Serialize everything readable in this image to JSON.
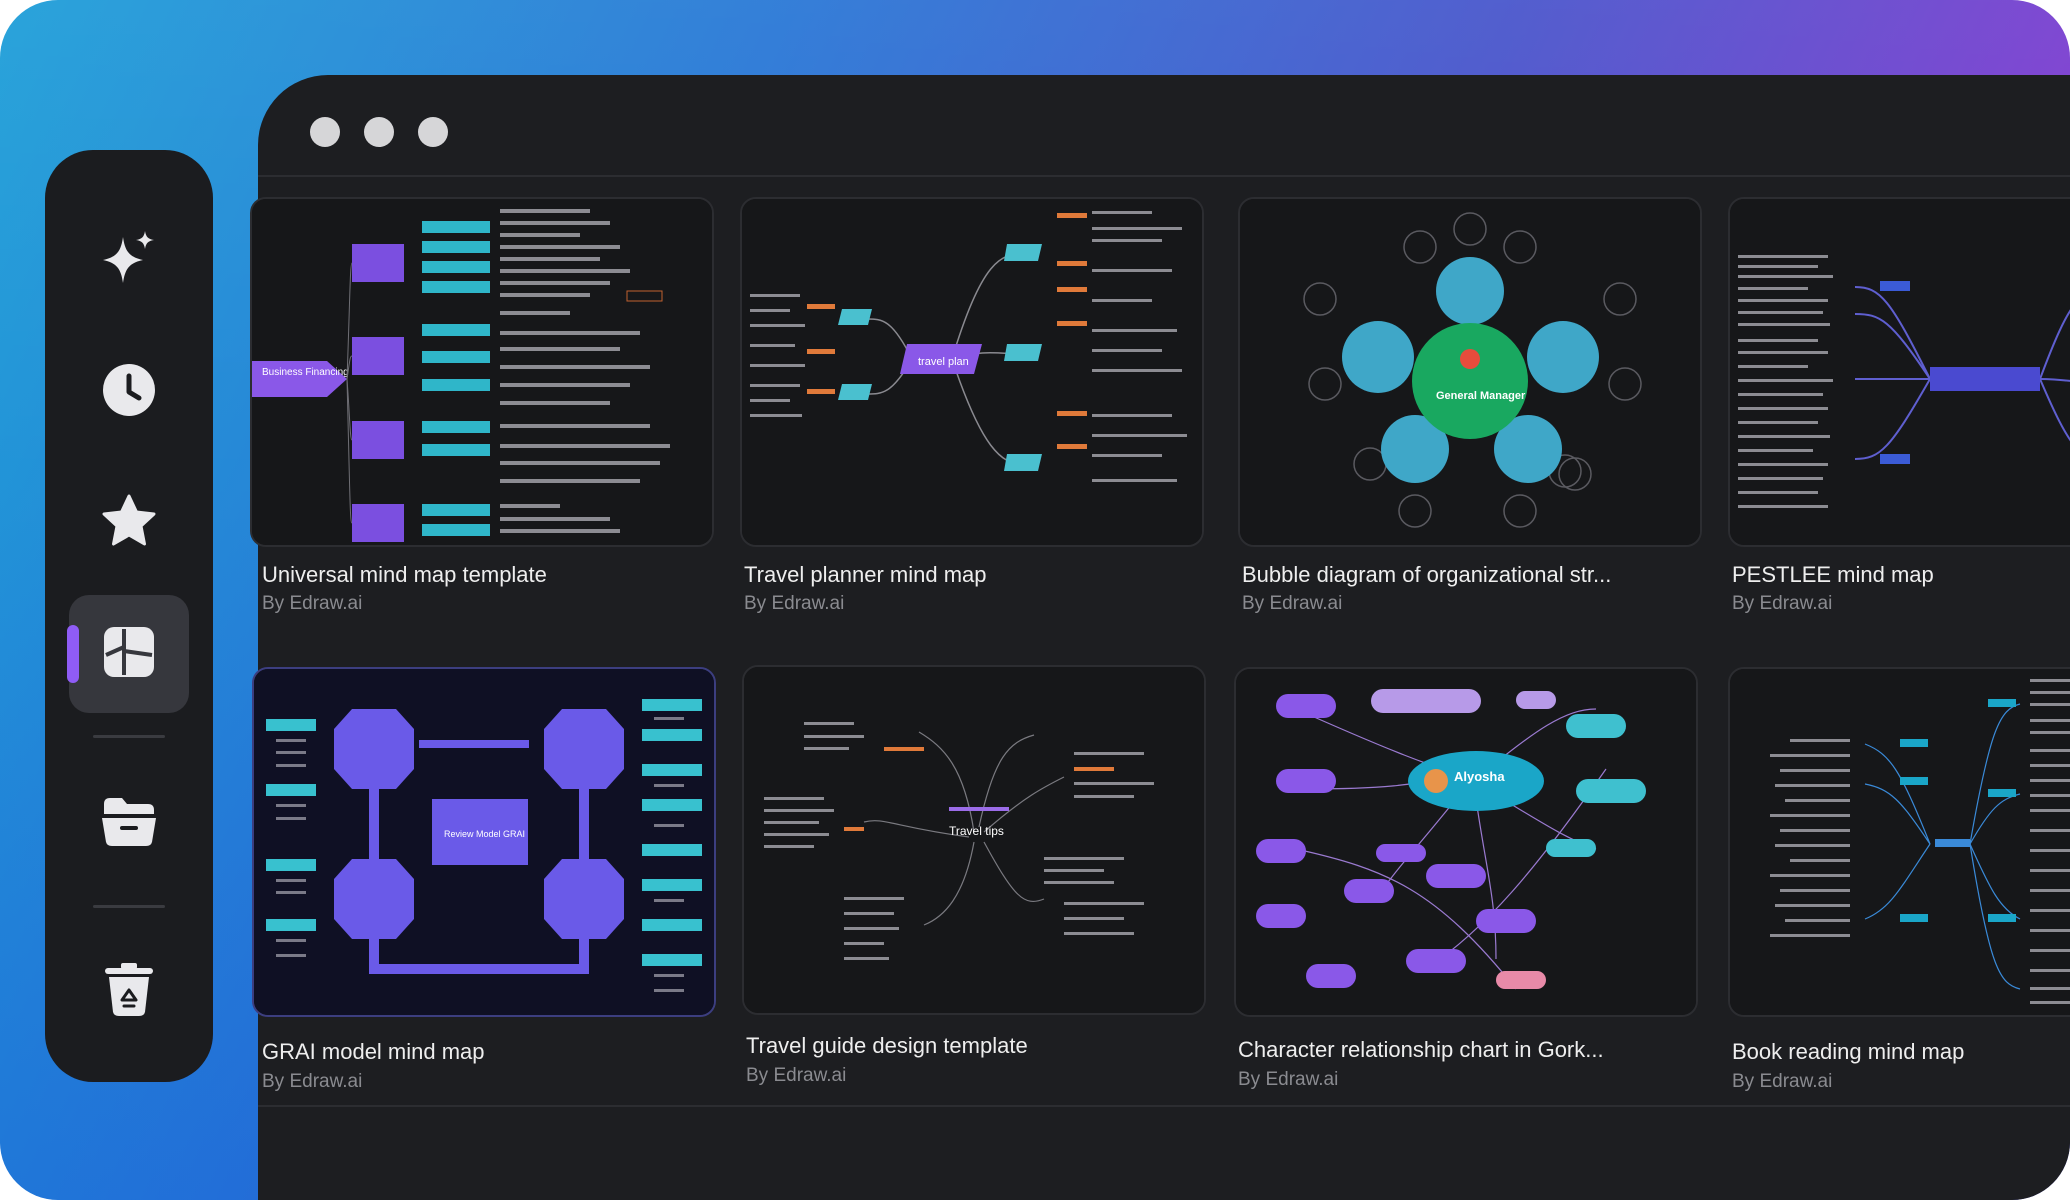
{
  "window": {
    "controls": [
      "close",
      "minimize",
      "maximize"
    ]
  },
  "sidebar": {
    "items": [
      {
        "name": "ai-sparkle",
        "icon": "sparkle-icon"
      },
      {
        "name": "recent",
        "icon": "clock-icon"
      },
      {
        "name": "favorites",
        "icon": "star-icon"
      },
      {
        "name": "templates",
        "icon": "template-gallery-icon",
        "active": true
      },
      {
        "name": "files",
        "icon": "folder-icon"
      },
      {
        "name": "recycle-bin",
        "icon": "recycle-bin-icon"
      }
    ],
    "accent": "#8f5cf6"
  },
  "templates": [
    {
      "title": "Universal mind map template",
      "author": "By Edraw.ai",
      "thumb_labels": [
        "Business Financing Plan"
      ]
    },
    {
      "title": "Travel planner mind map",
      "author": "By Edraw.ai",
      "thumb_labels": [
        "travel plan"
      ]
    },
    {
      "title": "Bubble diagram of organizational str...",
      "author": "By Edraw.ai",
      "thumb_labels": [
        "General Manager"
      ]
    },
    {
      "title": "PESTLEE mind map",
      "author": "By Edraw.ai",
      "thumb_labels": []
    },
    {
      "title": "GRAI model mind map",
      "author": "By Edraw.ai",
      "thumb_labels": [
        "Review Model GRAI"
      ]
    },
    {
      "title": "Travel guide design template",
      "author": "By Edraw.ai",
      "thumb_labels": [
        "Travel tips"
      ]
    },
    {
      "title": "Character relationship chart in Gork...",
      "author": "By Edraw.ai",
      "thumb_labels": [
        "Alyosha"
      ]
    },
    {
      "title": "Book reading mind map",
      "author": "By Edraw.ai",
      "thumb_labels": []
    }
  ],
  "colors": {
    "background_gradient": [
      "#1f9fd8",
      "#7b3fd0"
    ],
    "window_bg": "#1d1e21",
    "sidebar_bg": "#1b1c1f",
    "text_primary": "#eeeeee",
    "text_secondary": "#8a8b90"
  }
}
